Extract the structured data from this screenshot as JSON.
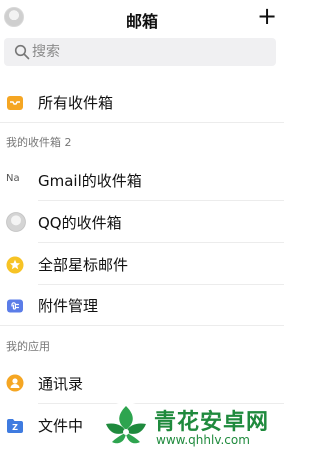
{
  "header": {
    "title": "邮箱",
    "add_label": "+"
  },
  "search": {
    "placeholder": "搜索"
  },
  "all_inbox": {
    "label": "所有收件箱"
  },
  "section_inboxes": {
    "label": "我的收件箱 2"
  },
  "inboxes": [
    {
      "label": "Gmail的收件箱",
      "icon": "gmail-icon",
      "icon_text": "Na"
    },
    {
      "label": "QQ的收件箱",
      "icon": "qq-avatar-icon"
    }
  ],
  "starred": {
    "label": "全部星标邮件"
  },
  "attachments": {
    "label": "附件管理"
  },
  "section_apps": {
    "label": "我的应用"
  },
  "apps": [
    {
      "label": "通讯录",
      "icon": "contacts-icon"
    },
    {
      "label": "文件中",
      "icon": "file-folder-icon"
    }
  ],
  "watermark": {
    "text": "青花安卓网",
    "url": "www.qhhlv.com"
  },
  "colors": {
    "orange": "#f5a623",
    "star_yellow": "#f7c325",
    "blue": "#5b7de8",
    "watermark_green": "#1f8a3d"
  }
}
